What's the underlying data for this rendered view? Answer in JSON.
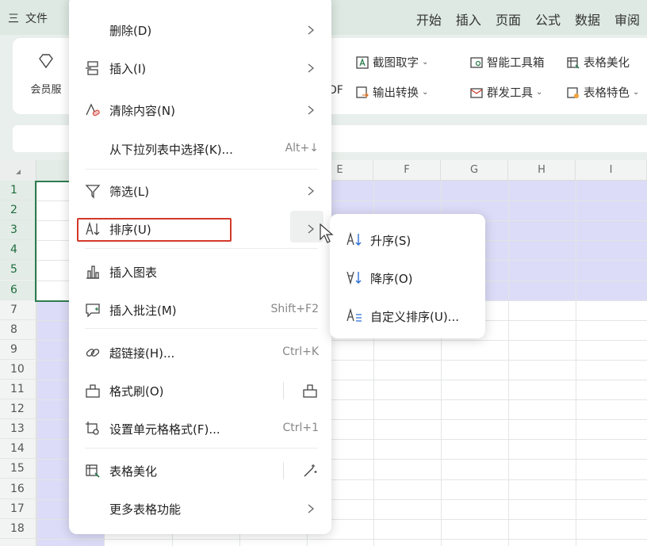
{
  "topbar": {
    "hamburger": "三",
    "file": "文件",
    "tabs": [
      "开始",
      "插入",
      "页面",
      "公式",
      "数据",
      "审阅"
    ]
  },
  "ribbon": {
    "member_label": "会员服",
    "pdf_label": "DF",
    "screenshot": "截图取字",
    "output": "输出转换",
    "smart_tools": "智能工具箱",
    "mass_send": "群发工具",
    "beautify": "表格美化",
    "table_special": "表格特色"
  },
  "grid": {
    "col_labels": [
      "E",
      "F",
      "G",
      "H",
      "I"
    ],
    "row_labels": [
      "1",
      "2",
      "3",
      "4",
      "5",
      "6",
      "7",
      "8",
      "9",
      "10",
      "11",
      "12",
      "13",
      "14",
      "15",
      "16",
      "17",
      "18"
    ],
    "selected_rows": 6
  },
  "context_menu": {
    "items": [
      {
        "label": "删除(D)",
        "shortcut": "",
        "submenu": true
      },
      {
        "label": "插入(I)",
        "shortcut": "",
        "submenu": true
      },
      {
        "label": "清除内容(N)",
        "shortcut": "",
        "submenu": true
      },
      {
        "label": "从下拉列表中选择(K)...",
        "shortcut": "Alt+↓",
        "submenu": false
      },
      {
        "label": "筛选(L)",
        "shortcut": "",
        "submenu": true
      },
      {
        "label": "排序(U)",
        "shortcut": "",
        "submenu": true
      },
      {
        "label": "插入图表",
        "shortcut": "",
        "submenu": false
      },
      {
        "label": "插入批注(M)",
        "shortcut": "Shift+F2",
        "submenu": false
      },
      {
        "label": "超链接(H)...",
        "shortcut": "Ctrl+K",
        "submenu": false
      },
      {
        "label": "格式刷(O)",
        "shortcut": "",
        "submenu": false
      },
      {
        "label": "设置单元格格式(F)...",
        "shortcut": "Ctrl+1",
        "submenu": false
      },
      {
        "label": "表格美化",
        "shortcut": "",
        "submenu": false
      },
      {
        "label": "更多表格功能",
        "shortcut": "",
        "submenu": true
      }
    ]
  },
  "sort_submenu": {
    "items": [
      {
        "label": "升序(S)"
      },
      {
        "label": "降序(O)"
      },
      {
        "label": "自定义排序(U)..."
      }
    ]
  },
  "colors": {
    "accent_green": "#2e7d4f",
    "highlight_red": "#d23a2a",
    "selection_blue": "#dcdcf8"
  }
}
